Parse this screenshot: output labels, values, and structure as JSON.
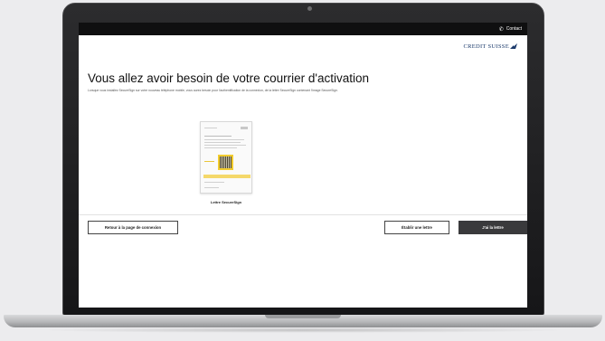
{
  "header": {
    "contact_label": "Contact",
    "phone_icon": "phone-icon"
  },
  "brand": {
    "logo_text": "CREDIT SUISSE",
    "color": "#1b3a6b"
  },
  "main": {
    "title": "Vous allez avoir besoin de votre courrier d'activation",
    "description": "Lorsque vous installez SecureSign sur votre nouveau téléphone mobile, vous aurez besoin pour l'authentification de la connexion, de la lettre SecureSign contenant l'image SecureSign.",
    "letter_caption": "Lettre SecureSign"
  },
  "actions": {
    "back_label": "Retour à la page de connexion",
    "create_label": "Établir une lettre",
    "have_label": "J'ai la lettre",
    "primary_color": "#3a3a3c"
  }
}
